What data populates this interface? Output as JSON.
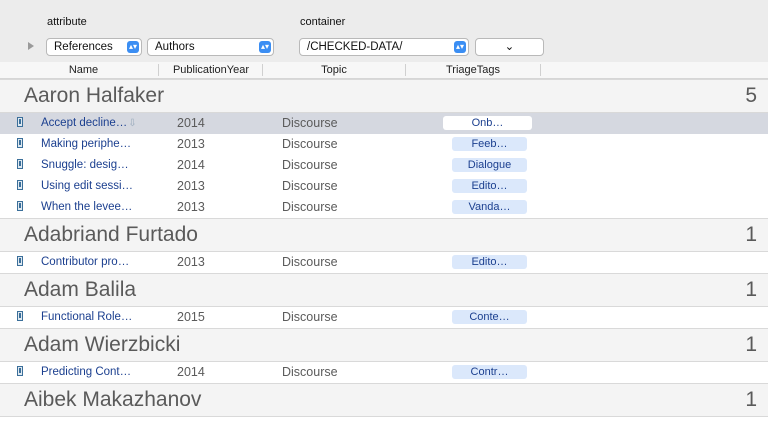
{
  "toolbar": {
    "attribute_label": "attribute",
    "container_label": "container",
    "type_popup": "References",
    "attribute_popup": "Authors",
    "container_popup": "/CHECKED-DATA/",
    "extra_popup": "⌄"
  },
  "columns": [
    "Name",
    "PublicationYear",
    "Topic",
    "TriageTags"
  ],
  "groups": [
    {
      "name": "Aaron Halfaker",
      "count": "5",
      "rows": [
        {
          "name": "Accept decline…",
          "year": "2014",
          "topic": "Discourse",
          "tag": "Onb…",
          "selected": true,
          "cloud": "⇩"
        },
        {
          "name": "Making periphe…",
          "year": "2013",
          "topic": "Discourse",
          "tag": "Feeb…"
        },
        {
          "name": "Snuggle: desig…",
          "year": "2014",
          "topic": "Discourse",
          "tag": "Dialogue"
        },
        {
          "name": "Using edit sessi…",
          "year": "2013",
          "topic": "Discourse",
          "tag": "Edito…"
        },
        {
          "name": "When the levee…",
          "year": "2013",
          "topic": "Discourse",
          "tag": "Vanda…"
        }
      ]
    },
    {
      "name": "Adabriand Furtado",
      "count": "1",
      "rows": [
        {
          "name": "Contributor pro…",
          "year": "2013",
          "topic": "Discourse",
          "tag": "Edito…"
        }
      ]
    },
    {
      "name": "Adam Balila",
      "count": "1",
      "rows": [
        {
          "name": "Functional Role…",
          "year": "2015",
          "topic": "Discourse",
          "tag": "Conte…"
        }
      ]
    },
    {
      "name": "Adam Wierzbicki",
      "count": "1",
      "rows": [
        {
          "name": "Predicting Cont…",
          "year": "2014",
          "topic": "Discourse",
          "tag": "Contr…"
        }
      ]
    },
    {
      "name": "Aibek Makazhanov",
      "count": "1",
      "rows": []
    }
  ]
}
